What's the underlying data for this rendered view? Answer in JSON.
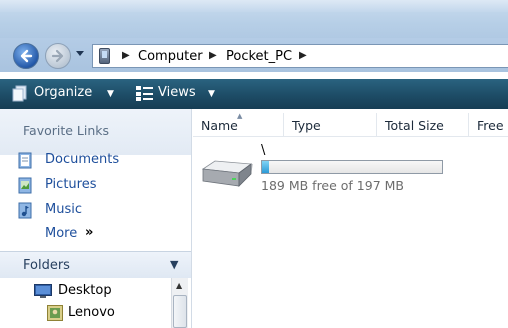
{
  "address": {
    "crumbs": [
      "Computer",
      "Pocket_PC"
    ]
  },
  "toolbar": {
    "organize_label": "Organize",
    "views_label": "Views"
  },
  "nav": {
    "favorite_links_title": "Favorite Links",
    "links": [
      {
        "label": "Documents",
        "icon": "documents-icon"
      },
      {
        "label": "Pictures",
        "icon": "pictures-icon"
      },
      {
        "label": "Music",
        "icon": "music-icon"
      }
    ],
    "more_label": "More",
    "more_chevron": "»",
    "folders_title": "Folders",
    "tree": [
      {
        "label": "Desktop",
        "icon": "desktop-icon"
      },
      {
        "label": "Lenovo",
        "icon": "user-folder-icon"
      }
    ]
  },
  "columns": [
    {
      "label": "Name"
    },
    {
      "label": "Type"
    },
    {
      "label": "Total Size"
    },
    {
      "label": "Free S"
    }
  ],
  "drive": {
    "name": "\\",
    "free_text": "189 MB free of 197 MB",
    "used_fraction": 0.04,
    "fill_color": "#2b9ad6"
  },
  "colors": {
    "command_bar": "#1d4c66",
    "link_text": "#1e4f9c"
  }
}
